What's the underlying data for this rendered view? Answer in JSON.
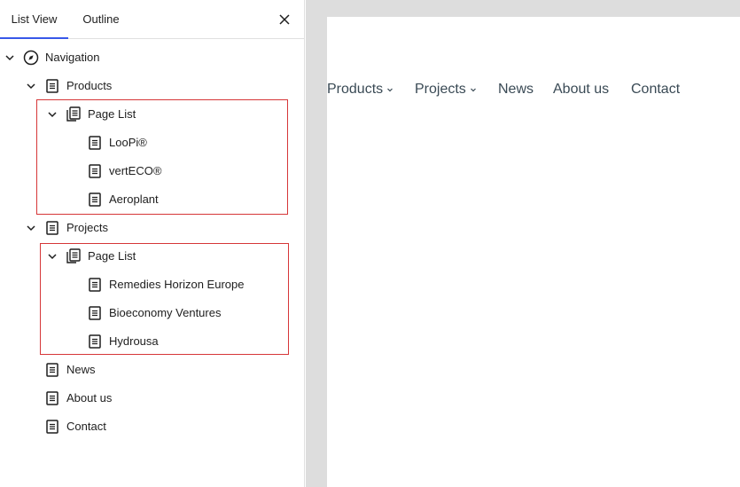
{
  "sidebar": {
    "tabs": [
      {
        "label": "List View",
        "active": true
      },
      {
        "label": "Outline",
        "active": false
      }
    ],
    "close_icon": "close-icon",
    "tree": {
      "root": {
        "label": "Navigation",
        "icon": "compass-icon"
      },
      "products": {
        "label": "Products",
        "icon": "page-icon"
      },
      "products_pagelist": {
        "label": "Page List",
        "icon": "pages-icon"
      },
      "products_children": [
        {
          "label": "LooPi®"
        },
        {
          "label": "vertECO®"
        },
        {
          "label": "Aeroplant"
        }
      ],
      "projects": {
        "label": "Projects",
        "icon": "page-icon"
      },
      "projects_pagelist": {
        "label": "Page List",
        "icon": "pages-icon"
      },
      "projects_children": [
        {
          "label": "Remedies Horizon Europe"
        },
        {
          "label": "Bioeconomy Ventures"
        },
        {
          "label": "Hydrousa"
        }
      ],
      "tail": [
        {
          "label": "News"
        },
        {
          "label": "About us"
        },
        {
          "label": "Contact"
        }
      ]
    },
    "highlight_color": "#d63638"
  },
  "canvas": {
    "nav": [
      {
        "label": "Products",
        "has_submenu": true
      },
      {
        "label": "Projects",
        "has_submenu": true
      },
      {
        "label": "News",
        "has_submenu": false
      },
      {
        "label": "About us",
        "has_submenu": false
      },
      {
        "label": "Contact",
        "has_submenu": false
      }
    ],
    "nav_color": "#3a4a55"
  }
}
